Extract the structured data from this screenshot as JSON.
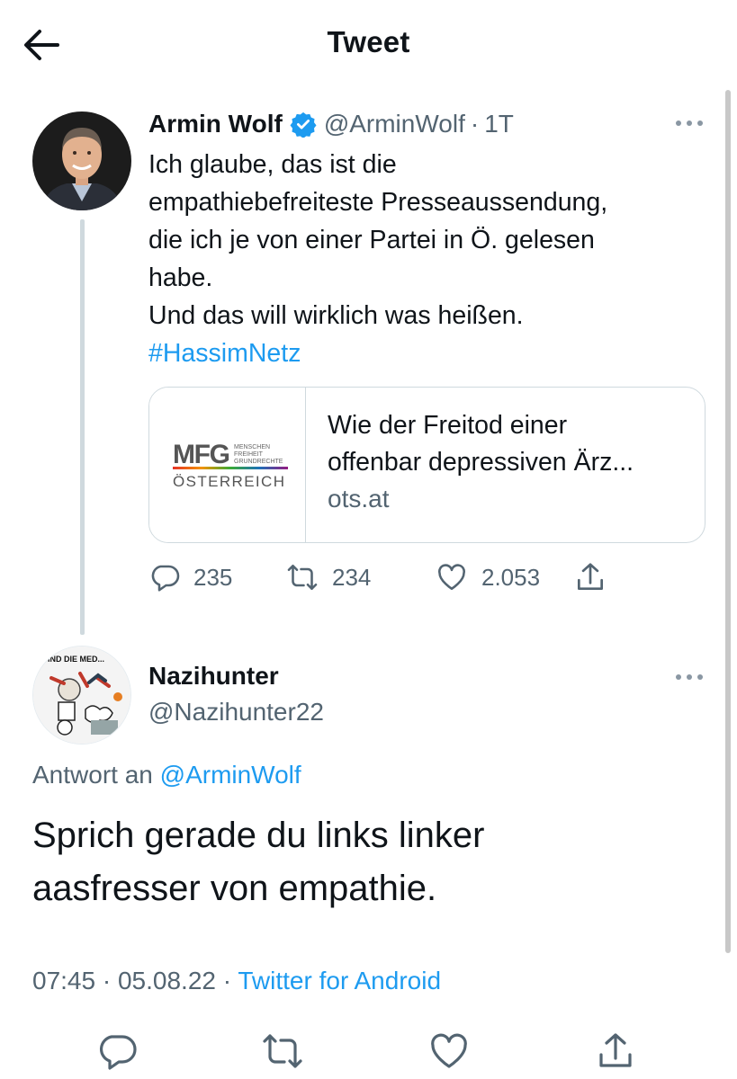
{
  "header": {
    "title": "Tweet",
    "back_icon": "arrow-left-icon"
  },
  "colors": {
    "link": "#1d9bf0",
    "secondary_text": "#536471",
    "border": "#cfd9de"
  },
  "tweet1": {
    "author_name": "Armin Wolf",
    "verified": true,
    "handle": "@ArminWolf",
    "separator": "·",
    "time": "1T",
    "lines": [
      "Ich glaube, das ist die",
      "empathiebefreiteste Presseaussendung,",
      "die ich je von einer Partei in Ö. gelesen",
      "habe.",
      "Und das will wirklich was heißen."
    ],
    "hashtag": "#HassimNetz",
    "card": {
      "logo_text": "MFG",
      "logo_sub": [
        "MENSCHEN",
        "FREIHEIT",
        "GRUNDRECHTE"
      ],
      "logo_country": "ÖSTERREICH",
      "title_lines": [
        "Wie der Freitod einer",
        "offenbar depressiven Ärz..."
      ],
      "domain": "ots.at"
    },
    "stats": {
      "replies": "235",
      "retweets": "234",
      "likes": "2.053"
    }
  },
  "tweet2": {
    "author_name": "Nazihunter",
    "handle": "@Nazihunter22",
    "avatar_text": "SIND DIE MED...",
    "reply_prefix": "Antwort an",
    "reply_to": "@ArminWolf",
    "lines": [
      "Sprich gerade du links linker",
      "aasfresser von empathie."
    ],
    "time": "07:45",
    "date": "05.08.22",
    "source": "Twitter for Android",
    "separator": "·"
  }
}
